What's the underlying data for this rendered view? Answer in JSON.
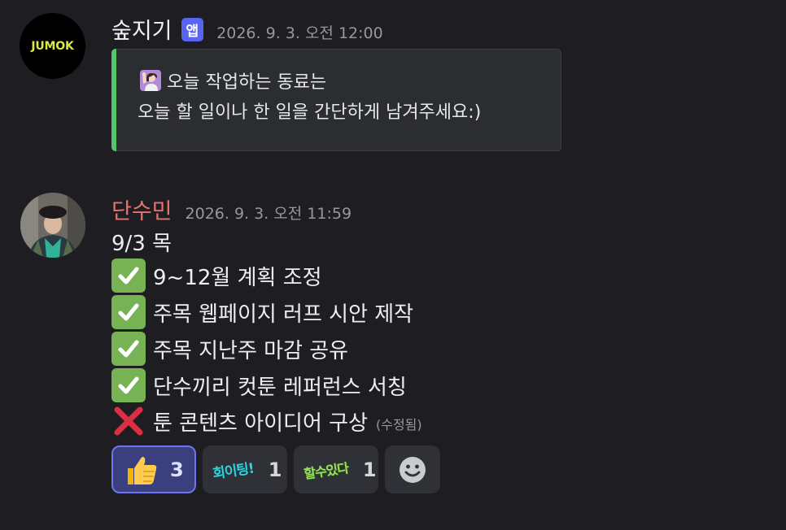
{
  "messages": [
    {
      "author": "숲지기",
      "badge": "앱",
      "timestamp": "2026. 9. 3. 오전 12:00",
      "avatar_text": "JUMOK",
      "embed": {
        "accent_color": "#57c56c",
        "line1": "오늘 작업하는 동료는",
        "line2": "오늘 할 일이나 한 일을 간단하게 남겨주세요:)"
      }
    },
    {
      "author": "단수민",
      "author_color": "#e8736c",
      "timestamp": "2026. 9. 3. 오전 11:59",
      "lines": [
        "9/3 목",
        "9~12월 계획 조정",
        "주목 웹페이지 러프 시안 제작",
        "주목 지난주 마감 공유",
        "단수끼리 컷툰 레퍼런스 서칭",
        "툰 콘텐츠 아이디어 구상"
      ],
      "edited_label": "(수정됨)",
      "reactions": [
        {
          "emoji": "thumbs-up-icon",
          "count": "3",
          "active": true
        },
        {
          "emoji": "회이팅!",
          "count": "1",
          "active": false
        },
        {
          "emoji": "할수있다",
          "count": "1",
          "active": false
        }
      ]
    }
  ]
}
